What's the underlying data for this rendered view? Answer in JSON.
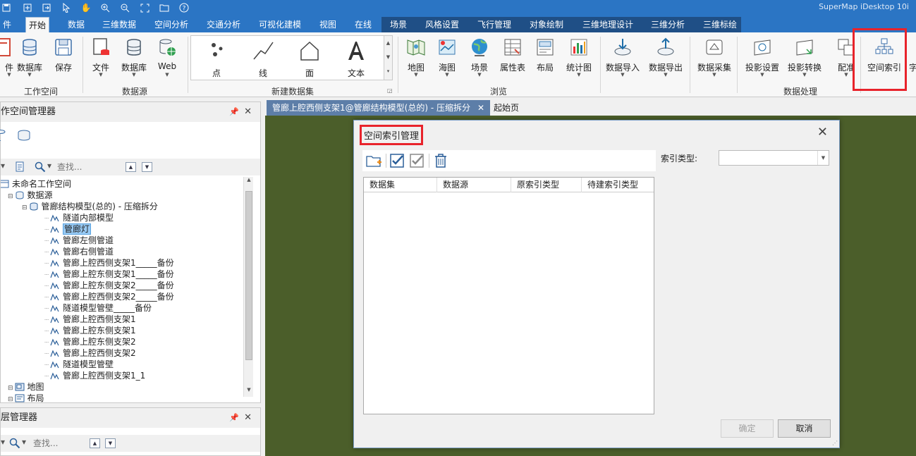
{
  "app": {
    "title": "SuperMap iDesktop 10i"
  },
  "ribbon_tabs": [
    "件",
    "开始",
    "数据",
    "三维数据",
    "空间分析",
    "交通分析",
    "可视化建模",
    "视图",
    "在线",
    "场景",
    "风格设置",
    "飞行管理",
    "对象绘制",
    "三维地理设计",
    "三维分析",
    "三维标绘"
  ],
  "ribbon_active_tab": "开始",
  "ribbon": {
    "workspace_group": {
      "label": "工作空间",
      "buttons": [
        "件",
        "数据库",
        "保存"
      ]
    },
    "datasource_group": {
      "label": "数据源",
      "buttons": [
        "文件",
        "数据库",
        "Web"
      ]
    },
    "new_dataset_group": {
      "label": "新建数据集",
      "items": [
        "点",
        "线",
        "面",
        "文本"
      ]
    },
    "browse_group": {
      "label": "浏览",
      "buttons": [
        "地图",
        "海图",
        "场景",
        "属性表",
        "布局",
        "统计图"
      ]
    },
    "data_processing_group": {
      "label": "数据处理",
      "buttons": [
        "数据导入",
        "数据导出",
        "数据采集",
        "投影设置",
        "投影转换",
        "配准",
        "空间索引",
        "字"
      ]
    }
  },
  "workspace_panel": {
    "title": "作空间管理器",
    "search_placeholder": "查找...",
    "tree": [
      {
        "label": "未命名工作空间",
        "level": 0,
        "icon": "workspace"
      },
      {
        "label": "数据源",
        "level": 1,
        "icon": "datasource"
      },
      {
        "label": "管廊结构模型(总的) - 压缩拆分",
        "level": 2,
        "icon": "database"
      },
      {
        "label": "隧道内部模型",
        "level": 3,
        "icon": "dataset"
      },
      {
        "label": "管廊灯",
        "level": 3,
        "icon": "dataset",
        "selected": true
      },
      {
        "label": "管廊左侧管道",
        "level": 3,
        "icon": "dataset"
      },
      {
        "label": "管廊右侧管道",
        "level": 3,
        "icon": "dataset"
      },
      {
        "label": "管廊上腔西侧支架1_____备份",
        "level": 3,
        "icon": "dataset"
      },
      {
        "label": "管廊上腔东侧支架1_____备份",
        "level": 3,
        "icon": "dataset"
      },
      {
        "label": "管廊上腔东侧支架2_____备份",
        "level": 3,
        "icon": "dataset"
      },
      {
        "label": "管廊上腔西侧支架2_____备份",
        "level": 3,
        "icon": "dataset"
      },
      {
        "label": "隧道模型管壁_____备份",
        "level": 3,
        "icon": "dataset"
      },
      {
        "label": "管廊上腔西侧支架1",
        "level": 3,
        "icon": "dataset"
      },
      {
        "label": "管廊上腔东侧支架1",
        "level": 3,
        "icon": "dataset"
      },
      {
        "label": "管廊上腔东侧支架2",
        "level": 3,
        "icon": "dataset"
      },
      {
        "label": "管廊上腔西侧支架2",
        "level": 3,
        "icon": "dataset"
      },
      {
        "label": "隧道模型管壁",
        "level": 3,
        "icon": "dataset"
      },
      {
        "label": "管廊上腔西侧支架1_1",
        "level": 3,
        "icon": "dataset"
      },
      {
        "label": "地图",
        "level": 1,
        "icon": "map"
      },
      {
        "label": "布局",
        "level": 1,
        "icon": "layout"
      }
    ]
  },
  "layer_panel": {
    "title": "层管理器",
    "search_placeholder": "查找..."
  },
  "doc_tabs": [
    {
      "label": "管廊上腔西侧支架1@管廊结构模型(总的) - 压缩拆分",
      "active": true
    },
    {
      "label": "起始页",
      "active": false
    }
  ],
  "dialog": {
    "title": "空间索引管理",
    "columns": [
      "数据集",
      "数据源",
      "原索引类型",
      "待建索引类型"
    ],
    "index_type_label": "索引类型:",
    "index_type_value": "",
    "ok_label": "确定",
    "cancel_label": "取消"
  }
}
